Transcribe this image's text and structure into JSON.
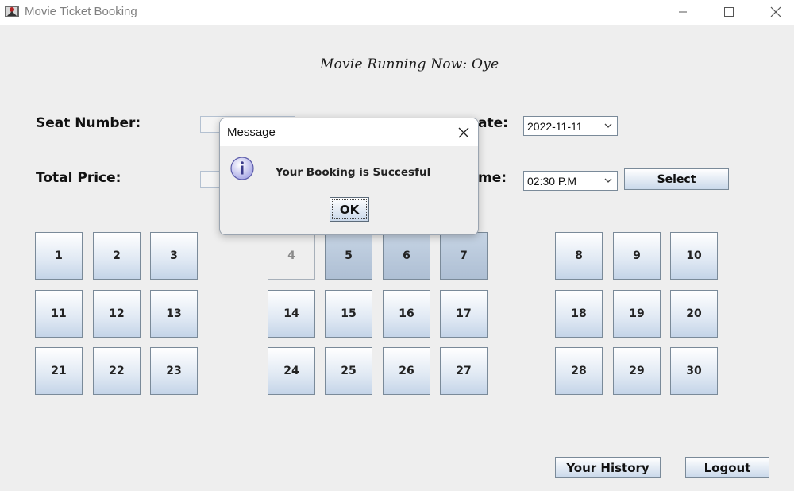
{
  "window": {
    "title": "Movie Ticket Booking",
    "icon": "app-logo-icon",
    "controls": [
      "minimize-icon",
      "maximize-icon",
      "close-icon"
    ]
  },
  "banner": {
    "text": "Movie Running Now: Oye"
  },
  "form": {
    "seat_number_label": "Seat Number:",
    "total_price_label": "Total Price:",
    "date_label_partial": "ate:",
    "time_label_partial": "me:",
    "date_value": "2022-11-11",
    "time_value": "02:30 P.M",
    "select_label": "Select"
  },
  "seats": {
    "left": [
      [
        "1",
        "2",
        "3"
      ],
      [
        "11",
        "12",
        "13"
      ],
      [
        "21",
        "22",
        "23"
      ]
    ],
    "middle": [
      [
        "4",
        "5",
        "6",
        "7"
      ],
      [
        "14",
        "15",
        "16",
        "17"
      ],
      [
        "24",
        "25",
        "26",
        "27"
      ]
    ],
    "right": [
      [
        "8",
        "9",
        "10"
      ],
      [
        "18",
        "19",
        "20"
      ],
      [
        "28",
        "29",
        "30"
      ]
    ],
    "disabled": [
      "4"
    ],
    "selected": [
      "5",
      "6",
      "7"
    ]
  },
  "footer": {
    "history_label": "Your History",
    "logout_label": "Logout"
  },
  "dialog": {
    "title": "Message",
    "message": "Your Booking is Succesful",
    "ok_label": "OK",
    "icon": "info-icon"
  },
  "colors": {
    "accent_border": "#7a8a99",
    "button_top": "#ffffff",
    "button_bottom": "#c9d8ea",
    "background": "#eeeeee"
  }
}
